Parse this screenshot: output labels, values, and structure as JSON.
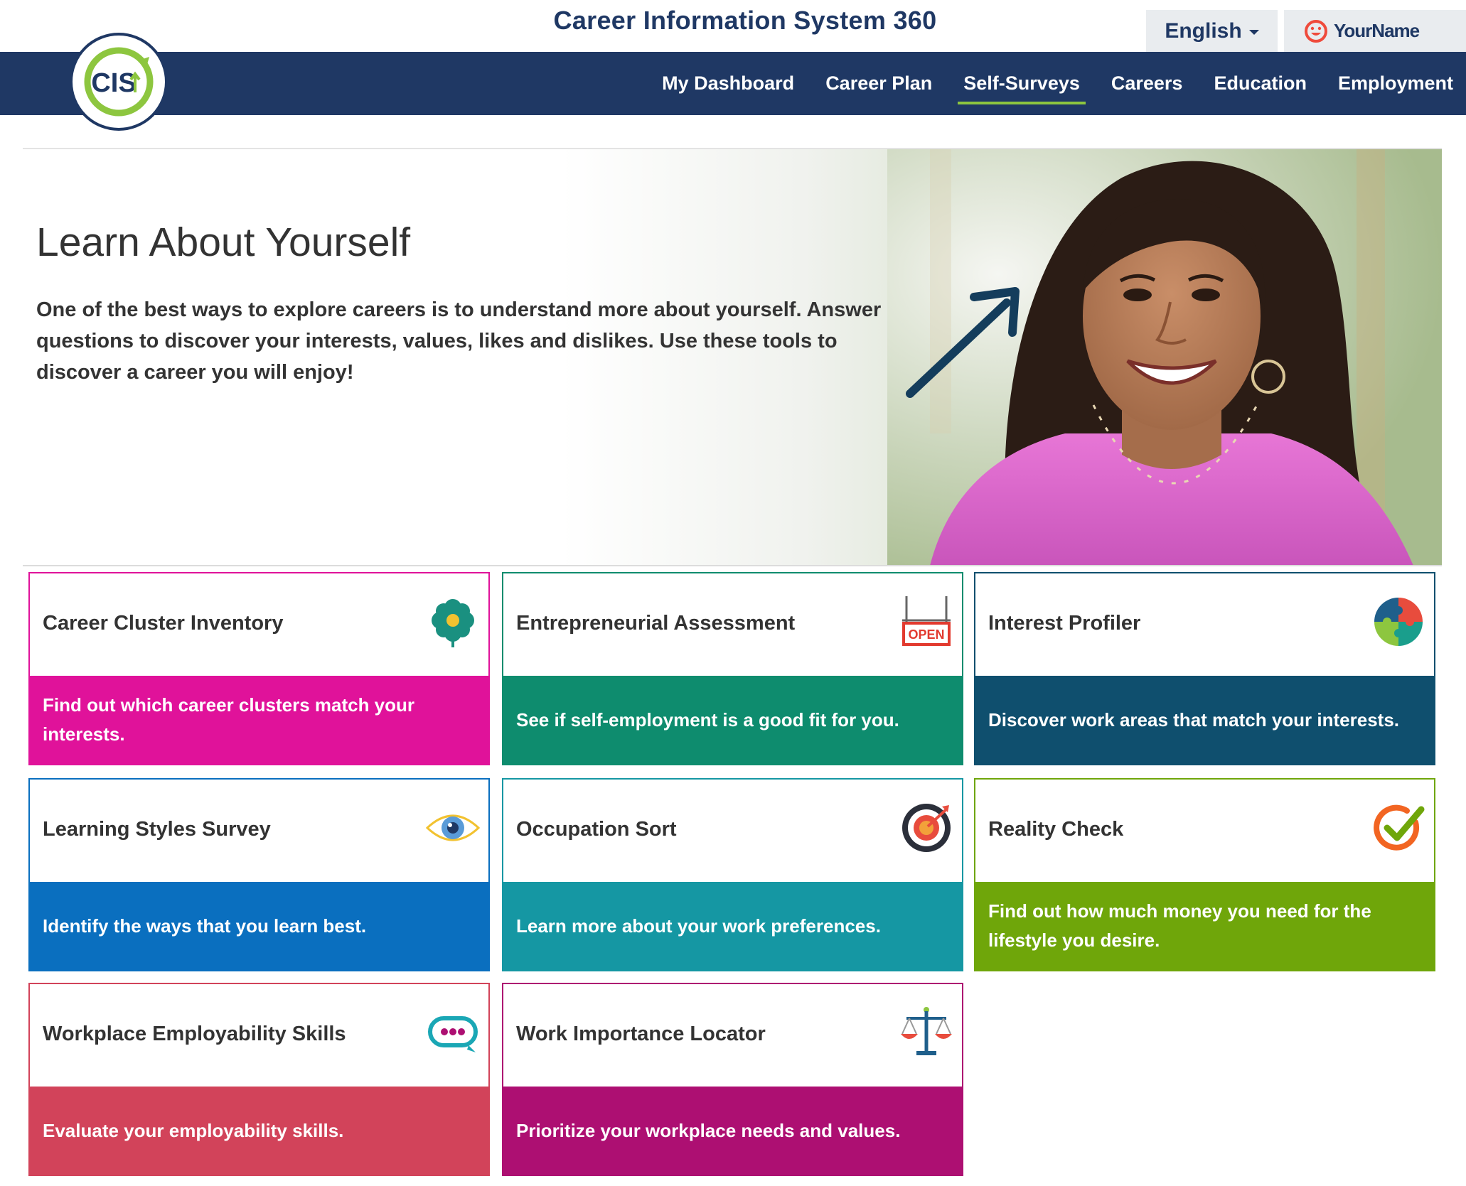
{
  "header": {
    "site_title": "Career Information System 360",
    "language": "English",
    "user_name": "YourName",
    "logo_text": "CIS"
  },
  "nav": {
    "items": [
      {
        "label": "My Dashboard",
        "active": false
      },
      {
        "label": "Career Plan",
        "active": false
      },
      {
        "label": "Self-Surveys",
        "active": true
      },
      {
        "label": "Careers",
        "active": false
      },
      {
        "label": "Education",
        "active": false
      },
      {
        "label": "Employment",
        "active": false
      }
    ]
  },
  "hero": {
    "title": "Learn About Yourself",
    "body": "One of the best ways to explore careers is to understand more about yourself. Answer questions to discover your interests, values, likes and dislikes. Use these tools to discover a career you will enjoy!"
  },
  "cards": [
    {
      "title": "Career Cluster Inventory",
      "description": "Find out which career clusters match your interests.",
      "icon": "flower-icon",
      "color": "#e0129a"
    },
    {
      "title": "Entrepreneurial Assessment",
      "description": "See if self-employment is a good fit for you.",
      "icon": "open-sign-icon",
      "color": "#0e8c6e",
      "icon_text": "OPEN"
    },
    {
      "title": "Interest Profiler",
      "description": "Discover work areas that match your interests.",
      "icon": "puzzle-icon",
      "color": "#0f4f6e"
    },
    {
      "title": "Learning Styles Survey",
      "description": "Identify the ways that you learn best.",
      "icon": "eye-icon",
      "color": "#0a6fbf"
    },
    {
      "title": "Occupation Sort",
      "description": "Learn more about your work preferences.",
      "icon": "target-icon",
      "color": "#1597a3"
    },
    {
      "title": "Reality Check",
      "description": "Find out how much money you need for the lifestyle you desire.",
      "icon": "checkmark-icon",
      "color": "#6fa60a"
    },
    {
      "title": "Workplace Employability Skills",
      "description": "Evaluate your employability skills.",
      "icon": "chat-bubble-icon",
      "color": "#d2435a"
    },
    {
      "title": "Work Importance Locator",
      "description": "Prioritize your workplace needs and values.",
      "icon": "scales-icon",
      "color": "#ad0f72"
    }
  ],
  "colors": {
    "navbar": "#1f3864",
    "accent_green": "#8dc63f",
    "arrow": "#143d5c"
  }
}
